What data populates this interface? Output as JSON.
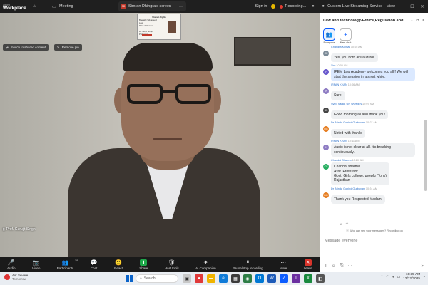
{
  "app": {
    "brand_line1": "zoom",
    "brand_line2": "Workplace",
    "meeting_label": "Meeting",
    "share_tab": "Simran Dhingra's screen",
    "share_tab_icon": "SD",
    "signin": "Sign in",
    "recording": "Recording...",
    "streaming": "Custom Live Streaming Service",
    "view": "View"
  },
  "video": {
    "switch_label": "Switch to shared content",
    "remove_pin": "Remove pin",
    "participant_name": "Prof. Gurujit Singh",
    "slide_text": "Bharathi Vidyapeeth\nLaw\nRole of Women\n\nDr. Gurjit Singh\nProfessor",
    "slide_title": "Women Rights"
  },
  "toolbar": {
    "items": [
      {
        "label": "Audio",
        "icon": "🎤"
      },
      {
        "label": "Video",
        "icon": "📷"
      },
      {
        "label": "Participants",
        "icon": "👥",
        "badge": "18"
      },
      {
        "label": "Chat",
        "icon": "💬"
      },
      {
        "label": "React",
        "icon": "🙂"
      },
      {
        "label": "Share",
        "icon": "⬆"
      },
      {
        "label": "Host tools",
        "icon": "🛡"
      },
      {
        "label": "AI Companion",
        "icon": "✦"
      },
      {
        "label": "Pause/stop recording",
        "icon": "⏸"
      },
      {
        "label": "More",
        "icon": "⋯"
      },
      {
        "label": "Leave",
        "icon": "✕"
      }
    ]
  },
  "chat": {
    "title": "Law and technology-Ethics,Regulation and...",
    "tabs": [
      {
        "label": "Everyone",
        "icon": "👥"
      },
      {
        "label": "New chat",
        "icon": "+"
      }
    ],
    "messages": [
      {
        "sender": "Chandra Kumar",
        "time": "10:05 AM",
        "avatar": "CK",
        "color": "#7b8a97",
        "text": "Yes, you both are audible.",
        "own": false
      },
      {
        "sender": "You",
        "time": "10:05 AM",
        "avatar": "IP",
        "color": "#6a5acd",
        "text": "IPEM Law Academy welcomes you all!!  We will start the session in a short while.",
        "own": true
      },
      {
        "sender": "IRFAN KHAN",
        "time": "10:06 AM",
        "avatar": "IK",
        "color": "#8e7cc3",
        "text": "Sure.",
        "own": false
      },
      {
        "sender": "Syed Sadiq, UN WOMEN",
        "time": "10:07 AM",
        "avatar": "SS",
        "color": "#444",
        "text": "Good morning all and thank  you!",
        "own": false
      },
      {
        "sender": "Dr Brinda Gobind Gurbuxani",
        "time": "10:07 AM",
        "avatar": "DG",
        "color": "#e67e22",
        "text": "Noted with thanks",
        "own": false
      },
      {
        "sender": "IRFAN KHAN",
        "time": "10:11 AM",
        "avatar": "IK",
        "color": "#8e7cc3",
        "text": "Audio is not clear at all. It's breaking continuously.",
        "own": false
      },
      {
        "sender": "Chandni Sharma",
        "time": "10:20 AM",
        "avatar": "CS",
        "color": "#27ae60",
        "text": "Chandni sharma\nAsst. Professor\nGovt. Girls college, peeplu (Tonk)\nRajasthan",
        "own": false
      },
      {
        "sender": "Dr Brinda Gobind Gurbuxani",
        "time": "10:24 AM",
        "avatar": "DG",
        "color": "#e67e22",
        "text": "Thank you Respected Madam.",
        "own": false
      }
    ],
    "who_can_see": "Who can see your messages? Recording on",
    "input_placeholder": "Message everyone"
  },
  "taskbar": {
    "weather_title": "Air: Severe",
    "weather_sub": "Tomorrow",
    "search_placeholder": "Search",
    "time": "10:35 AM",
    "date": "12/12/2025"
  }
}
